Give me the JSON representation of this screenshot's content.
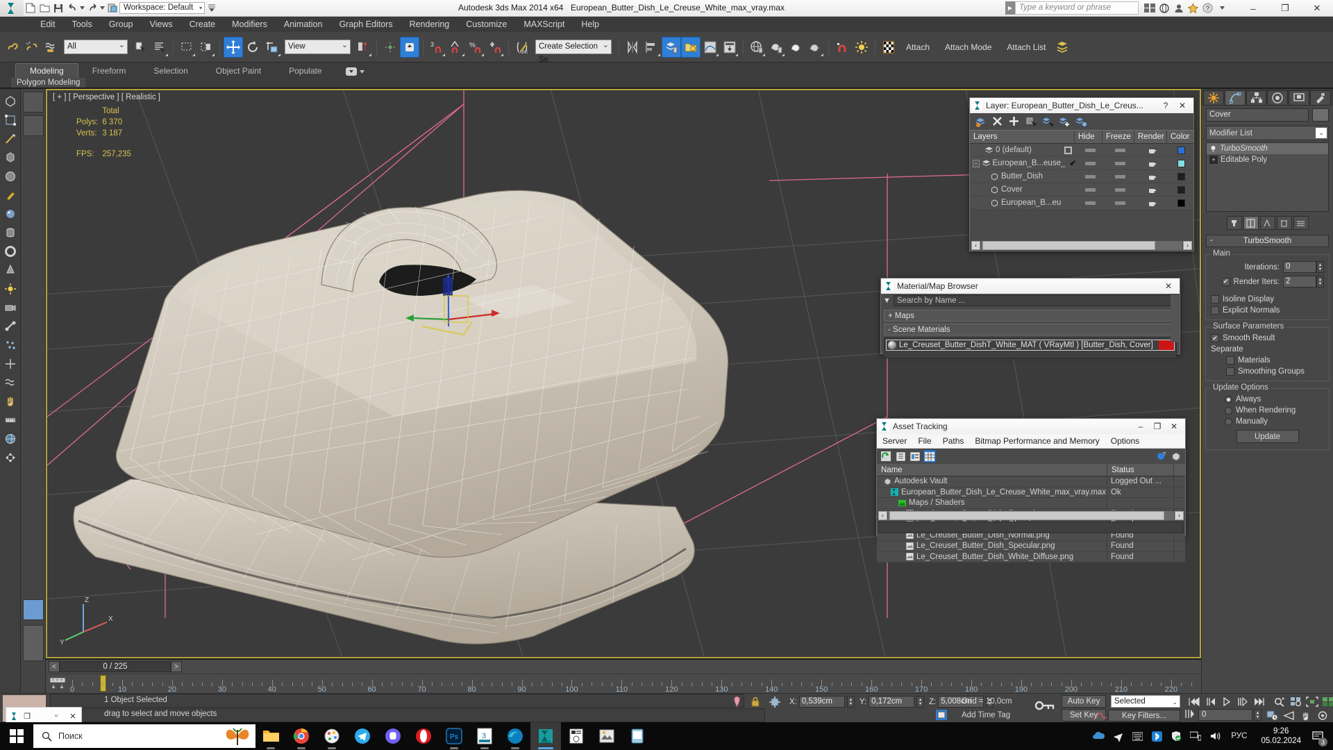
{
  "titlebar": {
    "workspace": "Workspace: Default",
    "app_title": "Autodesk 3ds Max  2014 x64",
    "file_title": "European_Butter_Dish_Le_Creuse_White_max_vray.max",
    "search_placeholder": "Type a keyword or phrase",
    "minimize": "–",
    "maximize": "❐",
    "close": "✕"
  },
  "menu": {
    "items": [
      "Edit",
      "Tools",
      "Group",
      "Views",
      "Create",
      "Modifiers",
      "Animation",
      "Graph Editors",
      "Rendering",
      "Customize",
      "MAXScript",
      "Help"
    ]
  },
  "toolbar": {
    "selection_filter": "All",
    "ref_coord_system": "View",
    "named_selection_set": "Create Selection Se",
    "attach": "Attach",
    "attach_mode": "Attach Mode",
    "attach_list": "Attach List"
  },
  "ribbon": {
    "tabs": [
      "Modeling",
      "Freeform",
      "Selection",
      "Object Paint",
      "Populate"
    ],
    "active_tab": "Modeling",
    "subtitle": "Polygon Modeling"
  },
  "viewport": {
    "label": "[ + ] [ Perspective ] [ Realistic ]",
    "stats_header": "Total",
    "polys_label": "Polys:",
    "polys_value": "6 370",
    "verts_label": "Verts:",
    "verts_value": "3 187",
    "fps_label": "FPS:",
    "fps_value": "257,235"
  },
  "layer_window": {
    "title": "Layer: European_Butter_Dish_Le_Creus...",
    "help": "?",
    "close": "✕",
    "columns": [
      "Layers",
      "Hide",
      "Freeze",
      "Render",
      "Color"
    ],
    "rows": [
      {
        "name": "0 (default)",
        "indent": 1,
        "current": false,
        "hasbox": true,
        "color": "#2b6fd6"
      },
      {
        "name": "European_B...euse_",
        "indent": 0,
        "current": true,
        "expand": "-",
        "color": "#83e0e0"
      },
      {
        "name": "Butter_Dish",
        "indent": 2,
        "current": false,
        "color": "#1e1e1e"
      },
      {
        "name": "Cover",
        "indent": 2,
        "current": false,
        "color": "#1e1e1e"
      },
      {
        "name": "European_B...eu",
        "indent": 2,
        "current": false,
        "color": "#000000"
      }
    ]
  },
  "material_browser": {
    "title": "Material/Map Browser",
    "close": "✕",
    "search_placeholder": "Search by Name ...",
    "maps_group": "+ Maps",
    "scene_materials_group": "- Scene Materials",
    "material": "Le_Creuset_Butter_DishT_White_MAT  ( VRayMtl )  [Butter_Dish, Cover]"
  },
  "asset_tracking": {
    "title": "Asset Tracking",
    "minimize": "–",
    "maximize": "❐",
    "close": "✕",
    "menu": [
      "Server",
      "File",
      "Paths",
      "Bitmap Performance and Memory",
      "Options"
    ],
    "columns": [
      "Name",
      "Status"
    ],
    "rows": [
      {
        "name": "Autodesk Vault",
        "status": "Logged Out ...",
        "indent": 0,
        "icon": "vault"
      },
      {
        "name": "European_Butter_Dish_Le_Creuse_White_max_vray.max",
        "status": "Ok",
        "indent": 1,
        "icon": "max"
      },
      {
        "name": "Maps / Shaders",
        "status": "",
        "indent": 2,
        "icon": "maps"
      },
      {
        "name": "Le_Creuset_Butter_Dish_Fresnel.png",
        "status": "Found",
        "indent": 3,
        "icon": "bitmap"
      },
      {
        "name": "Le_Creuset_Butter_Dish_Glossiness.png",
        "status": "Found",
        "indent": 3,
        "icon": "bitmap"
      },
      {
        "name": "Le_Creuset_Butter_Dish_Normal.png",
        "status": "Found",
        "indent": 3,
        "icon": "bitmap"
      },
      {
        "name": "Le_Creuset_Butter_Dish_Specular.png",
        "status": "Found",
        "indent": 3,
        "icon": "bitmap"
      },
      {
        "name": "Le_Creuset_Butter_Dish_White_Diffuse.png",
        "status": "Found",
        "indent": 3,
        "icon": "bitmap"
      }
    ]
  },
  "command_panel": {
    "object_name": "Cover",
    "modifier_list": "Modifier List",
    "stack": [
      {
        "label": "TurboSmooth",
        "selected": true,
        "icon": "bulb"
      },
      {
        "label": "Editable Poly",
        "selected": false,
        "icon": "plus"
      }
    ],
    "rollup_title": "TurboSmooth",
    "main_group": "Main",
    "iterations_label": "Iterations:",
    "iterations_value": "0",
    "render_iters_label": "Render Iters:",
    "render_iters_value": "2",
    "render_iters_checked": true,
    "isoline_display": "Isoline Display",
    "explicit_normals": "Explicit Normals",
    "surface_params_group": "Surface Parameters",
    "smooth_result": "Smooth Result",
    "smooth_result_checked": true,
    "separate_label": "Separate",
    "materials": "Materials",
    "smoothing_groups": "Smoothing Groups",
    "update_options_group": "Update Options",
    "update_always": "Always",
    "update_when_rendering": "When Rendering",
    "update_manually": "Manually",
    "update_button": "Update"
  },
  "timeline": {
    "current_frame_display": "0 / 225",
    "prev": "<",
    "next": ">",
    "tick_labels": [
      "0",
      "10",
      "20",
      "30",
      "40",
      "50",
      "60",
      "70",
      "80",
      "90",
      "100",
      "110",
      "120",
      "130",
      "140",
      "150",
      "160",
      "170",
      "180",
      "190",
      "200",
      "210",
      "220"
    ]
  },
  "statusbar": {
    "line1": "1 Object Selected",
    "line2": "drag to select and move objects",
    "x_label": "X:",
    "x_value": "0,539cm",
    "y_label": "Y:",
    "y_value": "0,172cm",
    "z_label": "Z:",
    "z_value": "5,008cm",
    "grid": "Grid = 10,0cm",
    "add_time_tag": "Add Time Tag",
    "auto_key": "Auto Key",
    "set_key": "Set Key",
    "key_mode": "Selected",
    "key_filters": "Key Filters...",
    "frame_value": "0"
  },
  "taskbar": {
    "search_placeholder": "Поиск",
    "language": "РУС",
    "time": "9:26",
    "date": "05.02.2024",
    "notification_count": "3"
  }
}
